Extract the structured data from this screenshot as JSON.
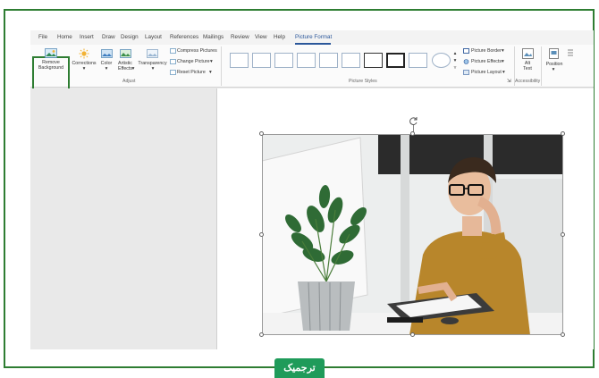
{
  "ribbon_tabs": [
    {
      "label": "File",
      "active": false
    },
    {
      "label": "Home",
      "active": false
    },
    {
      "label": "Insert",
      "active": false
    },
    {
      "label": "Draw",
      "active": false
    },
    {
      "label": "Design",
      "active": false
    },
    {
      "label": "Layout",
      "active": false
    },
    {
      "label": "References",
      "active": false
    },
    {
      "label": "Mailings",
      "active": false
    },
    {
      "label": "Review",
      "active": false
    },
    {
      "label": "View",
      "active": false
    },
    {
      "label": "Help",
      "active": false
    },
    {
      "label": "Picture Format",
      "active": true
    }
  ],
  "adjust_group": {
    "remove_background": "Remove\nBackground",
    "corrections": "Corrections",
    "color": "Color",
    "artistic_effects": "Artistic\nEffects",
    "transparency": "Transparency",
    "compress_pictures": "Compress Pictures",
    "change_picture": "Change Picture",
    "reset_picture": "Reset Picture",
    "label": "Adjust"
  },
  "picture_styles_group": {
    "label": "Picture Styles",
    "picture_border": "Picture Border",
    "picture_effects": "Picture Effects",
    "picture_layout": "Picture Layout"
  },
  "accessibility_group": {
    "alt_text": "Alt\nText",
    "label": "Accessibility"
  },
  "arrange_group": {
    "position": "Position"
  },
  "logo_text": "ترجمیک",
  "colors": {
    "frame_green": "#2e7d32",
    "accent_blue": "#2b579a",
    "logo_green": "#1f9b5a"
  }
}
